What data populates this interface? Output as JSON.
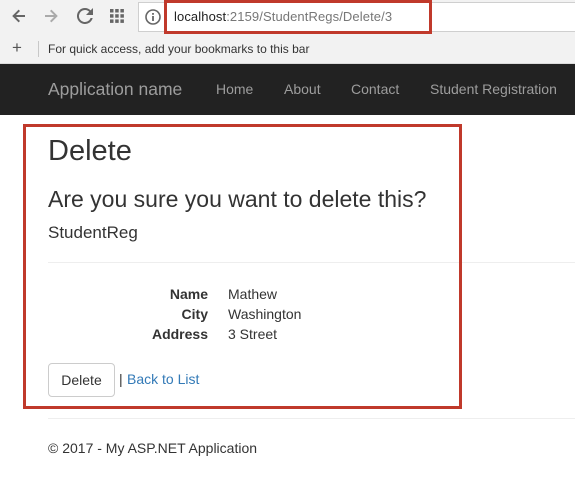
{
  "browser": {
    "url_host": "localhost",
    "url_path": ":2159/StudentRegs/Delete/3",
    "bookmarks_hint": "For quick access, add your bookmarks to this bar",
    "icons": [
      "back-arrow-icon",
      "forward-arrow-icon",
      "reload-icon",
      "apps-grid-icon",
      "info-icon",
      "plus-icon"
    ]
  },
  "navbar": {
    "brand": "Application name",
    "links": [
      "Home",
      "About",
      "Contact",
      "Student Registration"
    ]
  },
  "page": {
    "title": "Delete",
    "question": "Are you sure you want to delete this?",
    "entity": "StudentReg",
    "fields": [
      {
        "label": "Name",
        "value": "Mathew"
      },
      {
        "label": "City",
        "value": "Washington"
      },
      {
        "label": "Address",
        "value": "3 Street"
      }
    ],
    "delete_button": "Delete",
    "separator": "|",
    "back_link": "Back to List"
  },
  "footer": {
    "text": "© 2017 - My ASP.NET Application"
  },
  "colors": {
    "navbar_bg": "#222222",
    "nav_text": "#9d9d9d",
    "link": "#337ab7",
    "annotation_red": "#c0392b"
  }
}
